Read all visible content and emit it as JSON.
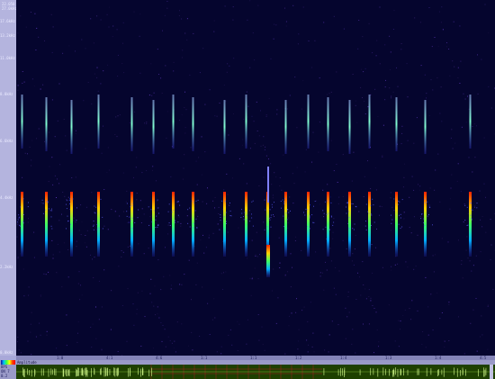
{
  "window": {
    "top_readout_1": "22.050",
    "top_readout_2": "27.0kHz"
  },
  "frequency_axis": {
    "ticks": [
      "17.6kHz",
      "13.2kHz",
      "11.0kHz",
      "8.8kHz",
      "6.6kHz",
      "4.4kHz",
      "2.2kHz",
      "0.0kHz"
    ]
  },
  "time_axis": {
    "ticks": [
      "1:0",
      "4:1",
      "4:6",
      "1:1",
      "1:1",
      "1:2",
      "1:4",
      "1:3",
      "1:4",
      "4:5"
    ]
  },
  "amplitude_panel": {
    "label": "Amplitude",
    "side_label_1": "BPS",
    "side_label_2": "ON 7",
    "side_label_3": "0.2"
  },
  "colors": {
    "background": "#05052e",
    "axis": "#b4b4de",
    "amplitude_bg": "#1e4000",
    "amplitude_signal": "#d8ff90",
    "gridline_red": "#a02020"
  },
  "pulses": {
    "x": [
      24,
      51,
      79,
      109,
      146,
      170,
      192,
      214,
      249,
      273,
      297,
      317,
      342,
      364,
      388,
      410,
      440,
      472,
      522
    ],
    "upper_present": [
      1,
      1,
      1,
      1,
      1,
      1,
      1,
      1,
      1,
      1,
      0,
      1,
      1,
      1,
      1,
      1,
      1,
      1,
      1
    ]
  }
}
